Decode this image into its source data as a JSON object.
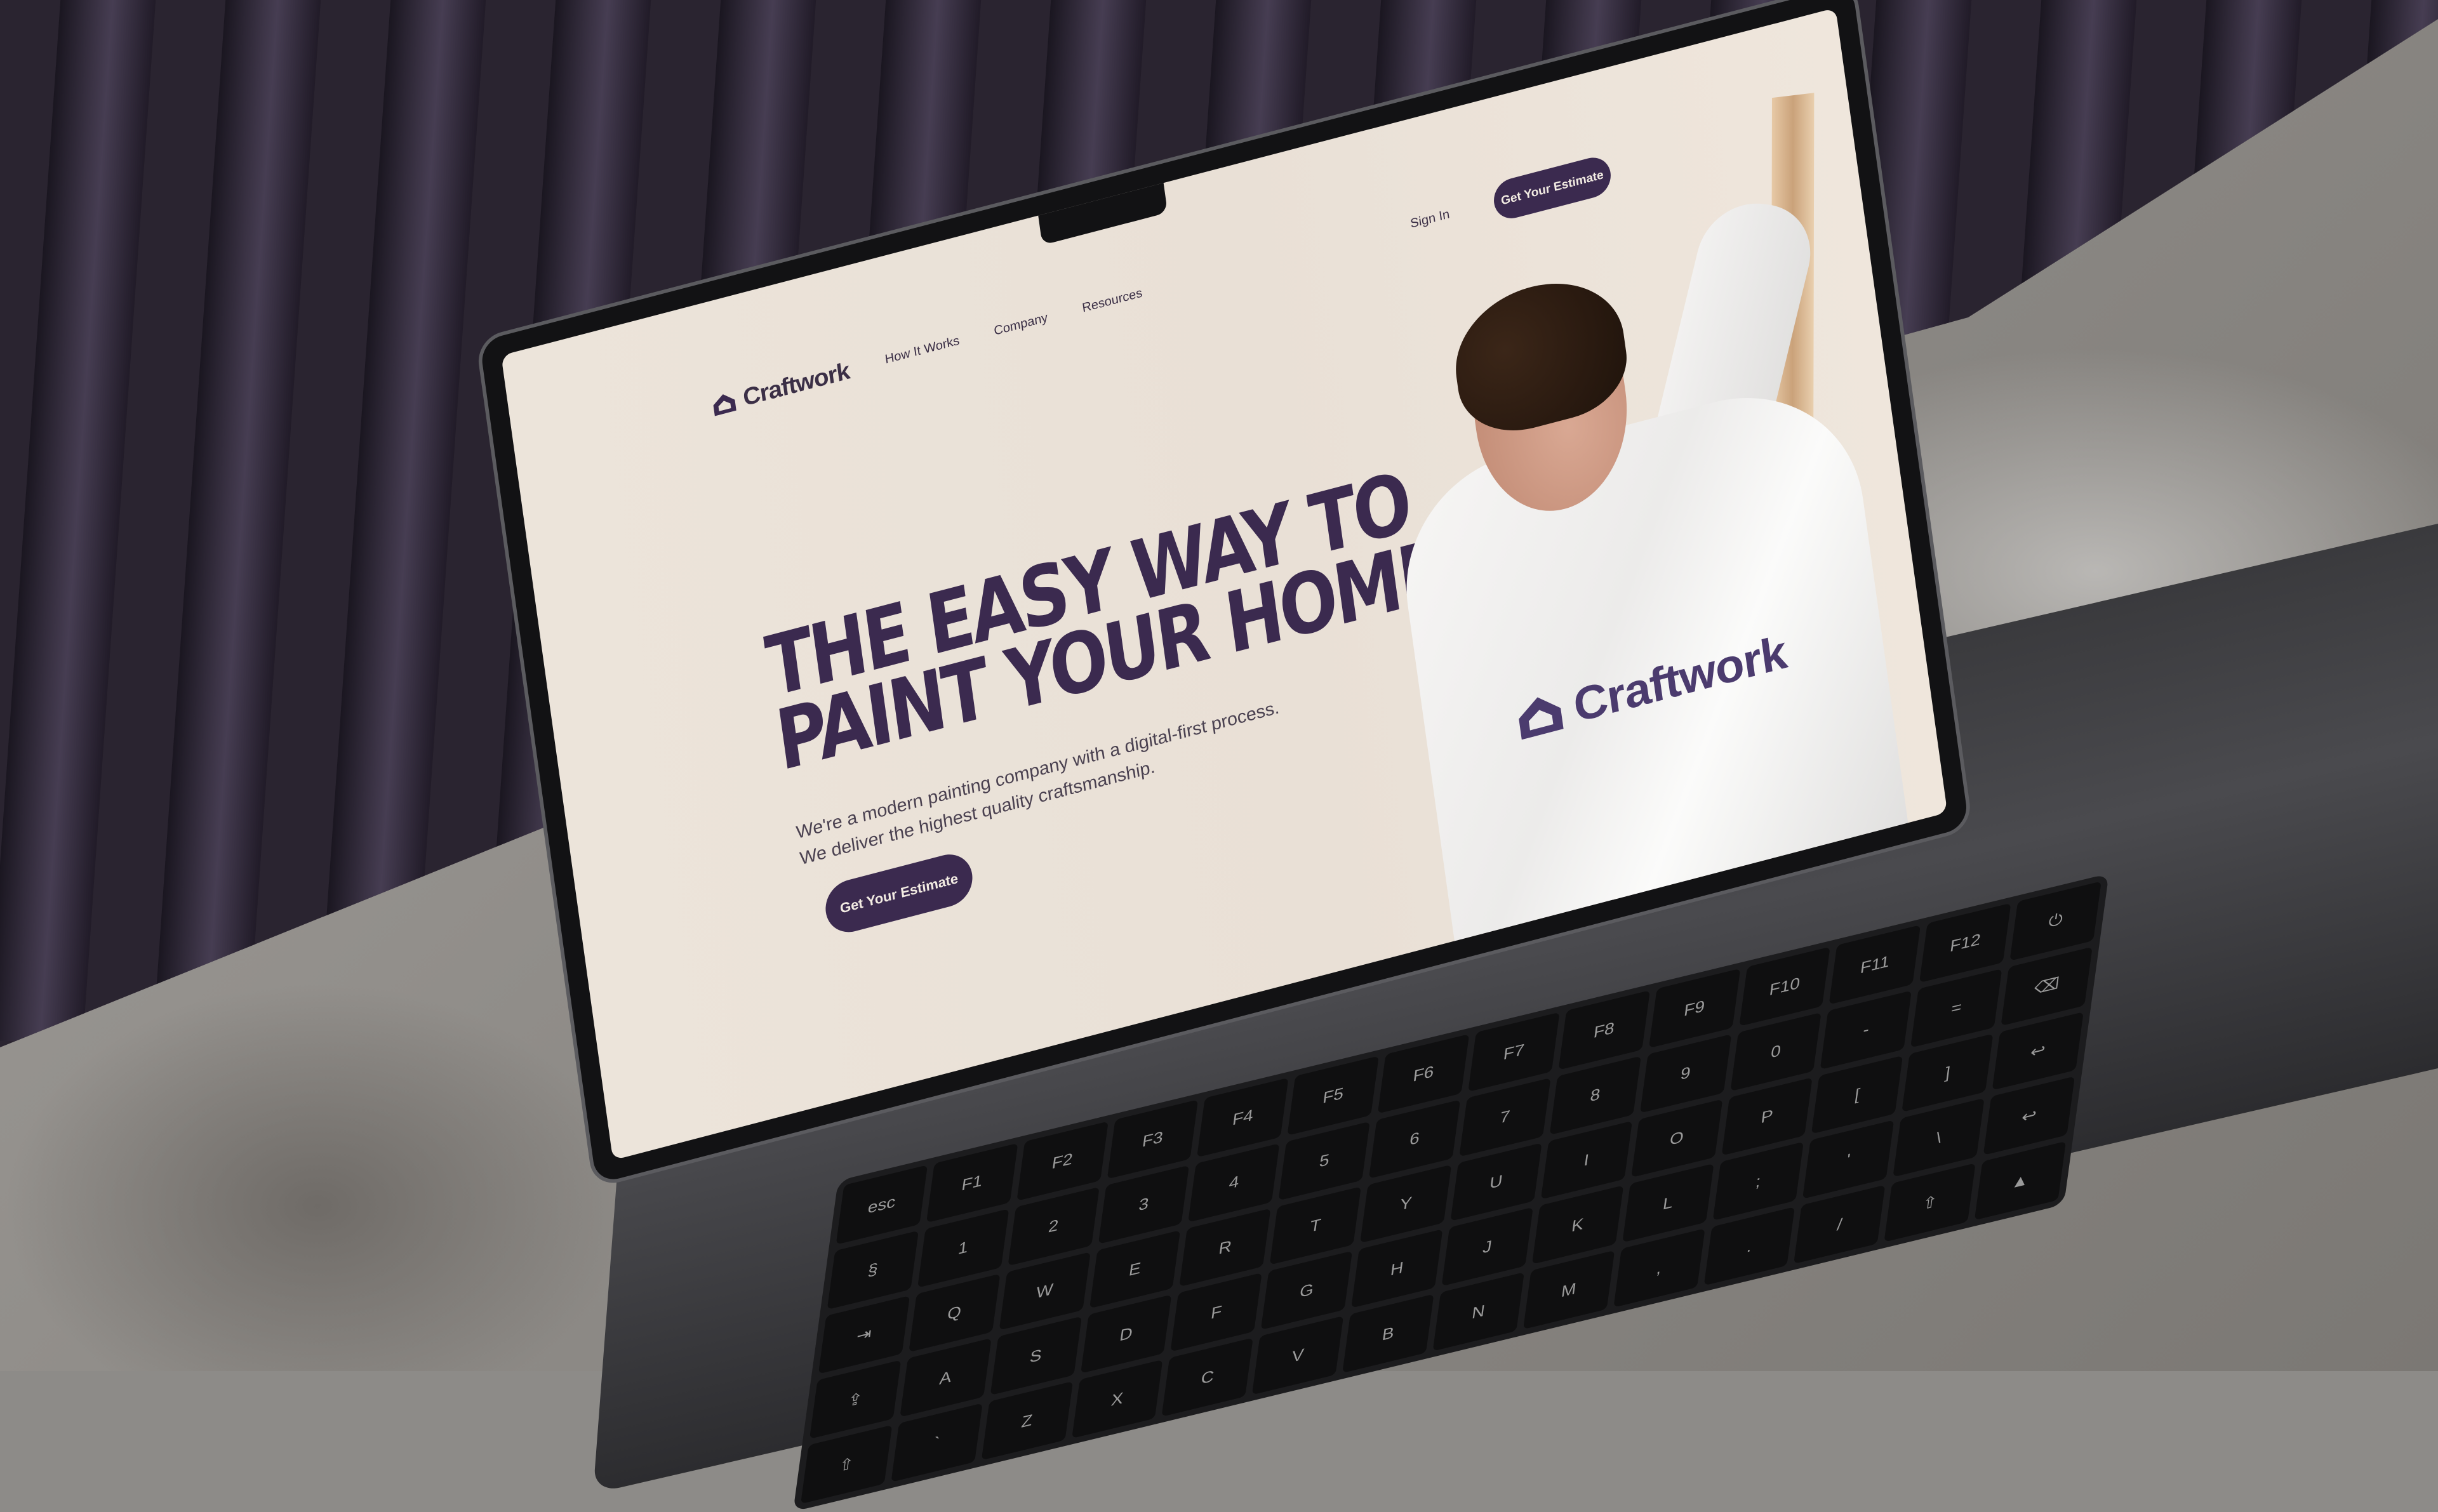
{
  "brand": {
    "name": "Craftwork",
    "primary_color": "#3b2a4f",
    "background_color": "#ece4da"
  },
  "nav": {
    "links": [
      "How It Works",
      "Company",
      "Resources"
    ],
    "sign_in": "Sign In",
    "cta": "Get Your Estimate"
  },
  "hero": {
    "title_line1": "THE EASY WAY TO",
    "title_line2": "PAINT YOUR HOME",
    "subtitle_line1": "We're a modern painting company with a digital-first process.",
    "subtitle_line2": "We deliver the highest quality craftsmanship.",
    "cta": "Get Your Estimate"
  },
  "photo": {
    "shirt_logo_text": "Craftwork"
  },
  "keyboard": {
    "keys": [
      "esc",
      "F1",
      "F2",
      "F3",
      "F4",
      "F5",
      "F6",
      "F7",
      "F8",
      "F9",
      "F10",
      "F11",
      "F12",
      "⏻",
      "§",
      "1",
      "2",
      "3",
      "4",
      "5",
      "6",
      "7",
      "8",
      "9",
      "0",
      "-",
      "=",
      "⌫",
      "⇥",
      "Q",
      "W",
      "E",
      "R",
      "T",
      "Y",
      "U",
      "I",
      "O",
      "P",
      "[",
      "]",
      "↩",
      "⇪",
      "A",
      "S",
      "D",
      "F",
      "G",
      "H",
      "J",
      "K",
      "L",
      ";",
      "'",
      "\\",
      "↩",
      "⇧",
      "`",
      "Z",
      "X",
      "C",
      "V",
      "B",
      "N",
      "M",
      ",",
      ".",
      "/",
      "⇧",
      "▲"
    ]
  }
}
